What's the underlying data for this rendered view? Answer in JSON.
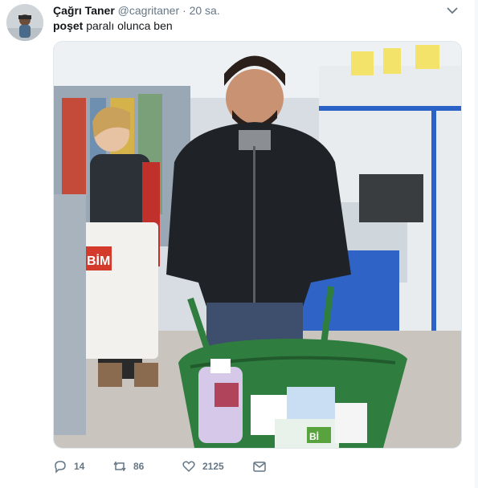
{
  "tweet": {
    "display_name": "Çağrı Taner",
    "handle": "@cagritaner",
    "separator": "·",
    "time": "20 sa.",
    "text_bold": "poşet",
    "text_rest": " paralı olunca ben"
  },
  "media": {
    "bag_text": "BİM",
    "package_text": "Bİ"
  },
  "actions": {
    "reply_count": "14",
    "retweet_count": "86",
    "like_count": "2125"
  },
  "icons": {
    "caret": "chevron-down-icon",
    "reply": "reply-icon",
    "retweet": "retweet-icon",
    "like": "heart-icon",
    "dm": "envelope-icon"
  },
  "colors": {
    "name": "#14171a",
    "secondary": "#657786",
    "wheelbarrow": "#2f7d3f",
    "border": "#e1e8ed"
  }
}
